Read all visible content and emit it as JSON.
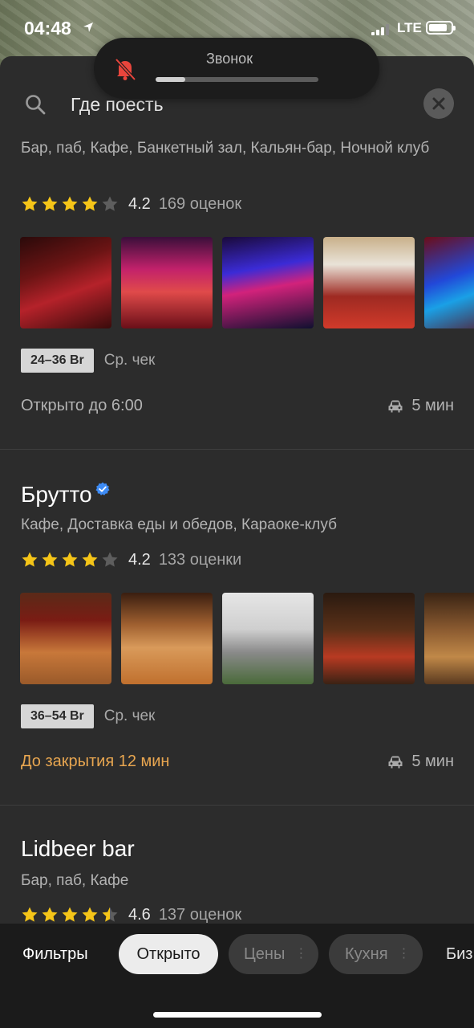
{
  "status_bar": {
    "time": "04:48",
    "network": "LTE",
    "icons": [
      "location-arrow-icon",
      "signal-bars-icon",
      "battery-icon"
    ]
  },
  "ringer_popup": {
    "title": "Звонок",
    "volume_level": 0.18,
    "icon": "bell-muted-icon",
    "icon_color": "#e8453c"
  },
  "search": {
    "query": "Где поесть",
    "icons": [
      "search-icon",
      "close-icon"
    ]
  },
  "results": [
    {
      "name": "",
      "categories": "Бар, паб, Кафе, Банкетный зал, Кальян-бар, Ночной клуб",
      "rating": 4.2,
      "rating_text": "4.2",
      "stars_filled": 4,
      "rating_count": "169 оценок",
      "price": "24–36 Br",
      "price_label": "Ср. чек",
      "open_status": "Открыто до 6:00",
      "open_status_color": "#b3b3b3",
      "drive_time": "5 мин"
    },
    {
      "name": "Брутто",
      "verified": true,
      "categories": "Кафе, Доставка еды и обедов, Караоке-клуб",
      "rating": 4.2,
      "rating_text": "4.2",
      "stars_filled": 4,
      "rating_count": "133 оценки",
      "price": "36–54 Br",
      "price_label": "Ср. чек",
      "open_status": "До закрытия 12 мин",
      "open_status_color": "#e8a650",
      "drive_time": "5 мин"
    },
    {
      "name": "Lidbeer bar",
      "categories": "Бар, паб, Кафе",
      "rating": 4.6,
      "rating_text": "4.6",
      "stars_filled": 4.5,
      "rating_count": "137 оценок"
    }
  ],
  "filter_bar": {
    "filters_label": "Фильтры",
    "chips": [
      {
        "label": "Открыто",
        "active": true
      },
      {
        "label": "Цены",
        "active": false
      },
      {
        "label": "Кухня",
        "active": false
      }
    ],
    "cut_label": "Биз"
  },
  "colors": {
    "accent_star": "#f5c518",
    "warning": "#e8a650",
    "verified": "#3d8bf5"
  }
}
